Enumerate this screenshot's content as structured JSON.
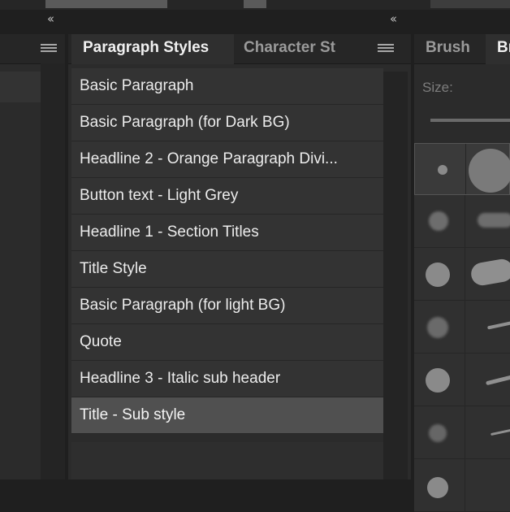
{
  "window": {
    "collapse_left": "‹‹",
    "collapse_right": "‹‹"
  },
  "center_panel": {
    "tabs": [
      {
        "label": "Paragraph Styles",
        "active": true
      },
      {
        "label": "Character St",
        "active": false
      }
    ],
    "styles": [
      {
        "label": "Basic Paragraph",
        "selected": false
      },
      {
        "label": "Basic Paragraph (for Dark BG)",
        "selected": false
      },
      {
        "label": "Headline 2 - Orange Paragraph Divi...",
        "selected": false
      },
      {
        "label": "Button text - Light Grey",
        "selected": false
      },
      {
        "label": "Headline 1 - Section Titles",
        "selected": false
      },
      {
        "label": "Title Style",
        "selected": false
      },
      {
        "label": "Basic Paragraph (for light BG)",
        "selected": false
      },
      {
        "label": "Quote",
        "selected": false
      },
      {
        "label": "Headline 3 - Italic sub header",
        "selected": false
      },
      {
        "label": "Title - Sub style",
        "selected": true
      }
    ]
  },
  "right_panel": {
    "tabs": [
      {
        "label": "Brush",
        "active": false
      },
      {
        "label": "Br",
        "active": true
      }
    ],
    "size_label": "Size:"
  },
  "colors": {
    "panel_bg": "#2b2b2b",
    "row_bg": "#333333",
    "selected_row": "#505050",
    "text": "#ececec",
    "muted_text": "#9a9a9a"
  }
}
